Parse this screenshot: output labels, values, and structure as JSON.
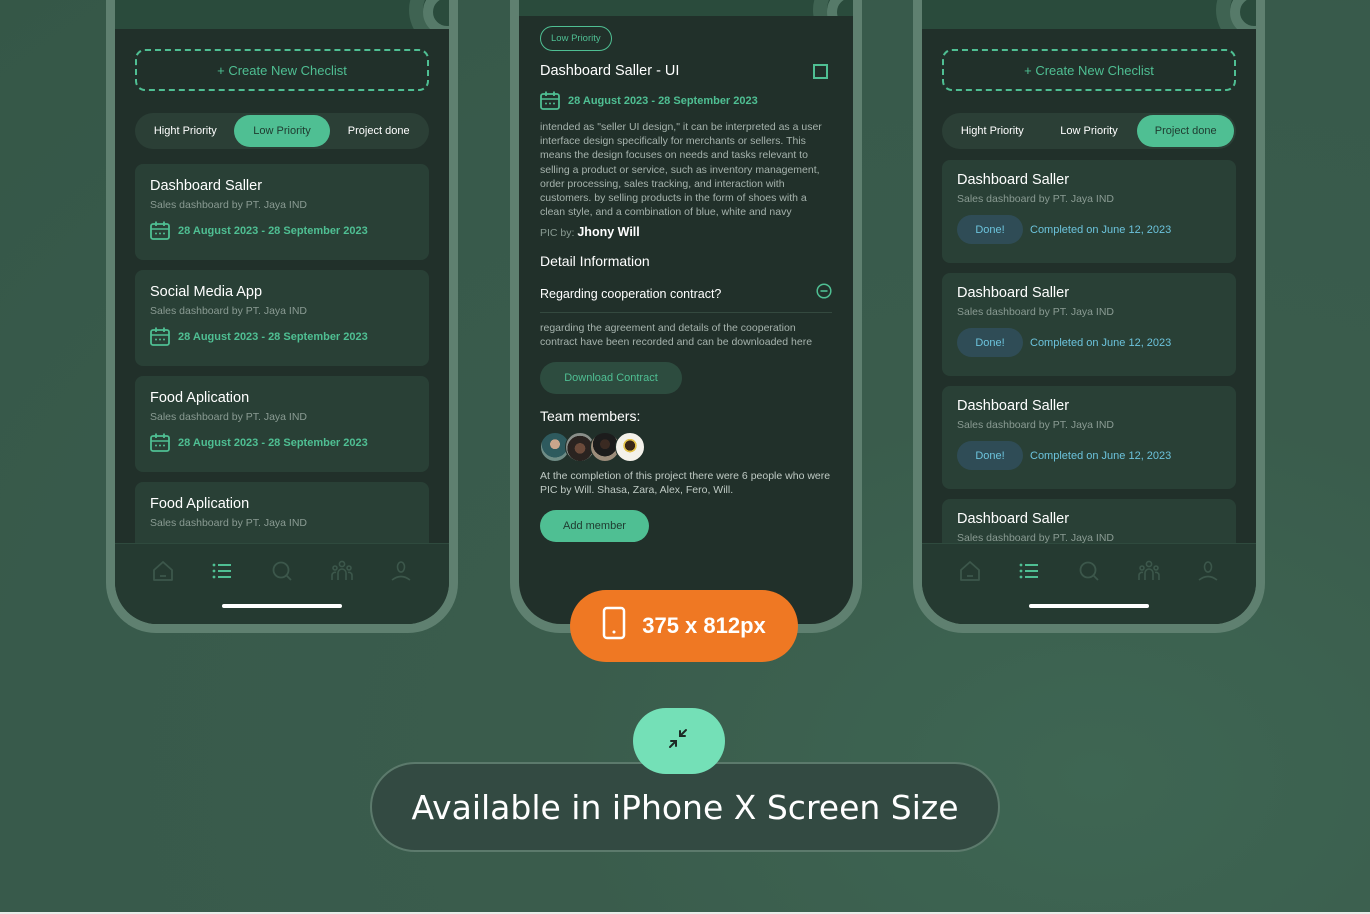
{
  "colors": {
    "accent": "#4fbf93",
    "background": "#385a4b",
    "screen": "#21302a",
    "card": "#294036",
    "done_pill": "#2f4c56",
    "done_text": "#6cc3dc",
    "orange": "#ef7823",
    "mint": "#74e0b7"
  },
  "screen_list": {
    "create_button": "+ Create New Checlist",
    "tabs": [
      {
        "label": "Hight Priority",
        "active": false
      },
      {
        "label": "Low Priority",
        "active": true
      },
      {
        "label": "Project done",
        "active": false
      }
    ],
    "cards": [
      {
        "title": "Dashboard Saller",
        "subtitle": "Sales dashboard by PT. Jaya IND",
        "date": "28 August 2023 - 28 September 2023"
      },
      {
        "title": "Social Media App",
        "subtitle": "Sales dashboard by PT. Jaya IND",
        "date": "28 August 2023 - 28 September 2023"
      },
      {
        "title": "Food Aplication",
        "subtitle": "Sales dashboard by PT. Jaya IND",
        "date": "28 August 2023 - 28 September 2023"
      },
      {
        "title": "Food Aplication",
        "subtitle": "Sales dashboard by PT. Jaya IND",
        "date": ""
      }
    ]
  },
  "screen_detail": {
    "priority_badge": "Low Priority",
    "title": "Dashboard Saller - UI",
    "date": "28 August 2023 - 28 September 2023",
    "description": "intended as \"seller UI design,\" it can be interpreted as a user interface design specifically for merchants or sellers. This means the design focuses on needs and tasks relevant to selling a product or service, such as inventory management, order processing, sales tracking, and interaction with customers. by selling products in the form of shoes with a clean style, and a combination of blue, white and navy",
    "pic_label": "PIC by:",
    "pic_name": "Jhony Will",
    "detail_heading": "Detail Information",
    "faq_question": "Regarding cooperation contract?",
    "faq_answer": "regarding the agreement and details of the cooperation contract have been recorded and can be downloaded here",
    "download_button": "Download Contract",
    "team_heading": "Team members:",
    "team_count": 4,
    "team_description": "At the completion of this project there were 6 people who were PIC by Will. Shasa, Zara, Alex, Fero, Will.",
    "add_member_button": "Add member"
  },
  "screen_done": {
    "create_button": "+ Create New Checlist",
    "tabs": [
      {
        "label": "Hight Priority",
        "active": false
      },
      {
        "label": "Low Priority",
        "active": false
      },
      {
        "label": "Project done",
        "active": true
      }
    ],
    "cards": [
      {
        "title": "Dashboard Saller",
        "subtitle": "Sales dashboard by PT. Jaya IND",
        "status": "Done!",
        "completed": "Completed on June 12, 2023"
      },
      {
        "title": "Dashboard Saller",
        "subtitle": "Sales dashboard by PT. Jaya IND",
        "status": "Done!",
        "completed": "Completed on June 12, 2023"
      },
      {
        "title": "Dashboard Saller",
        "subtitle": "Sales dashboard by PT. Jaya IND",
        "status": "Done!",
        "completed": "Completed on June 12, 2023"
      },
      {
        "title": "Dashboard Saller",
        "subtitle": "Sales dashboard by PT. Jaya IND",
        "status": "",
        "completed": ""
      }
    ]
  },
  "tabbar": {
    "icons": [
      "home-icon",
      "list-icon",
      "search-icon",
      "team-icon",
      "profile-icon"
    ],
    "active": "list-icon"
  },
  "size_badge": {
    "icon": "phone-icon",
    "label": "375 x 812px"
  },
  "promo": {
    "icon": "compress-icon",
    "label": "Available in iPhone X Screen Size"
  }
}
